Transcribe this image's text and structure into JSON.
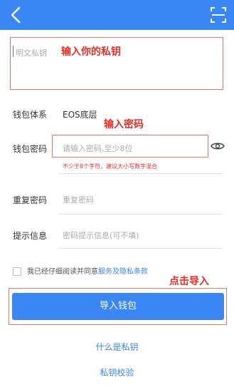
{
  "header": {
    "back_icon": "chevron-left-icon",
    "scan_icon": "scan-icon",
    "color": "#3a86f2"
  },
  "private_key": {
    "placeholder": "明文私钥",
    "annotation": "输入你的私钥"
  },
  "wallet_system": {
    "label": "钱包体系",
    "value": "EOS底层"
  },
  "password": {
    "label": "钱包密码",
    "placeholder": "请输入密码,至少8位",
    "hint": "不少于8个字符，建议大小写数字混合",
    "annotation": "输入密码",
    "toggle_icon": "eye-icon"
  },
  "repeat_password": {
    "label": "重复密码",
    "placeholder": "重复密码"
  },
  "password_hint": {
    "label": "提示信息",
    "placeholder": "密码提示信息(可不填)"
  },
  "agreement": {
    "text": "我已经仔细阅读并同意",
    "link": "服务及隐私条款",
    "checked": false
  },
  "import": {
    "annotation": "点击导入",
    "button_label": "导入钱包"
  },
  "links": {
    "what_is_key": "什么是私钥",
    "key_check": "私钥校验"
  },
  "annotation_color": "#e0302a"
}
